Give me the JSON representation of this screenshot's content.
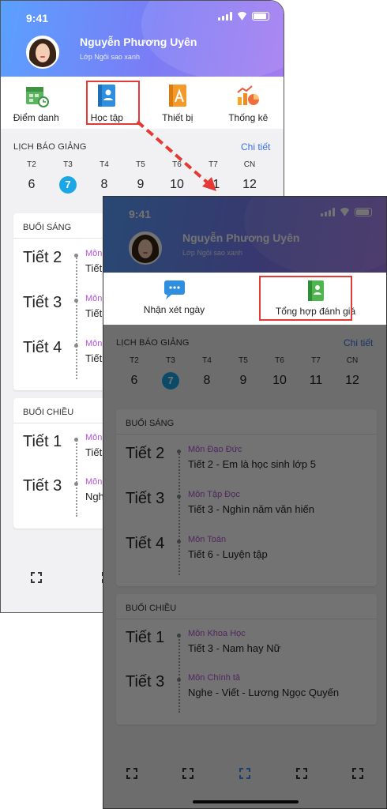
{
  "status": {
    "time": "9:41"
  },
  "user": {
    "name": "Nguyễn Phương Uyên",
    "class": "Lớp Ngôi sao xanh"
  },
  "menu": {
    "attendance": "Điểm danh",
    "study": "Học tập",
    "device": "Thiết bị",
    "stats": "Thống kê"
  },
  "submenu": {
    "daily_comment": "Nhận xét ngày",
    "summary_eval": "Tổng hợp đánh giá"
  },
  "schedule": {
    "title": "LỊCH BÁO GIẢNG",
    "detail": "Chi tiết",
    "days": [
      {
        "name": "T2",
        "date": "6"
      },
      {
        "name": "T3",
        "date": "7"
      },
      {
        "name": "T4",
        "date": "8"
      },
      {
        "name": "T5",
        "date": "9"
      },
      {
        "name": "T6",
        "date": "10"
      },
      {
        "name": "T7",
        "date": "11"
      },
      {
        "name": "CN",
        "date": "12"
      }
    ],
    "selected_day": "T3"
  },
  "morning": {
    "title": "BUỔI SÁNG",
    "items": [
      {
        "period": "Tiết 2",
        "subject": "Môn Đạo Đức",
        "lesson": "Tiết 2 - Em là học sinh lớp 5"
      },
      {
        "period": "Tiết 3",
        "subject": "Môn Tập Đọc",
        "lesson": "Tiết 3 - Nghìn năm văn hiến"
      },
      {
        "period": "Tiết 4",
        "subject": "Môn Toán",
        "lesson": "Tiết 6 - Luyện tập"
      }
    ]
  },
  "afternoon": {
    "title": "BUỔI CHIỀU",
    "items": [
      {
        "period": "Tiết 1",
        "subject": "Môn Khoa Học",
        "lesson": "Tiết 3 - Nam hay Nữ"
      },
      {
        "period": "Tiết 3",
        "subject": "Môn Chính tả",
        "lesson": "Nghe - Viết - Lương Ngọc Quyến"
      }
    ]
  },
  "screen1_truncated": {
    "subj_prefix": "Môn",
    "lesson_prefix": "Tiết",
    "lesson_prefix_last": "Nghe"
  },
  "colors": {
    "header_gradient_start": "#5aa0ff",
    "header_gradient_end": "#a37bf0",
    "accent_blue": "#1aa7e8",
    "subject_purple": "#b552d8",
    "highlight_red": "#e53935",
    "link_blue": "#3b6fe0"
  },
  "icons": [
    "attendance-icon",
    "study-icon",
    "device-icon",
    "stats-icon",
    "chat-icon",
    "report-icon",
    "fullscreen-icon"
  ]
}
